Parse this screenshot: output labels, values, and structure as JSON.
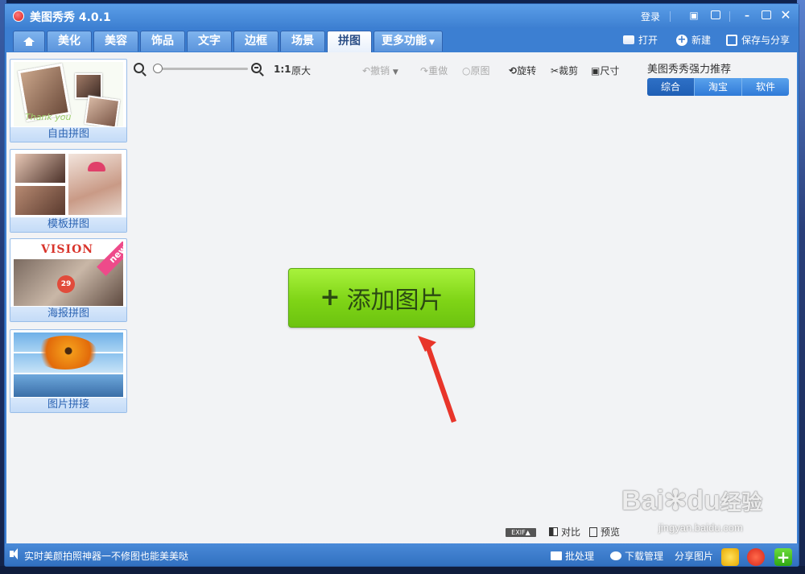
{
  "app": {
    "title": "美图秀秀 4.0.1"
  },
  "titlebar": {
    "login_label": "登录"
  },
  "tabs": [
    {
      "label": "",
      "icon": "home-icon"
    },
    {
      "label": "美化"
    },
    {
      "label": "美容"
    },
    {
      "label": "饰品"
    },
    {
      "label": "文字"
    },
    {
      "label": "边框"
    },
    {
      "label": "场景"
    },
    {
      "label": "拼图",
      "active": true
    },
    {
      "label": "更多功能"
    }
  ],
  "actions": {
    "open": "打开",
    "new": "新建",
    "save_share": "保存与分享"
  },
  "sidebar": {
    "cards": [
      {
        "label": "自由拼图",
        "thumb_text": "Thank you"
      },
      {
        "label": "模板拼图"
      },
      {
        "label": "海报拼图",
        "thumb_text": "VISION",
        "badge": "new",
        "dot_text": "29"
      },
      {
        "label": "图片拼接"
      }
    ]
  },
  "toolbar": {
    "zoom_ratio": "1:1",
    "original_size": "原大",
    "undo": "撤销",
    "redo": "重做",
    "original": "原图",
    "rotate": "旋转",
    "crop": "裁剪",
    "size": "尺寸"
  },
  "recommend": {
    "title": "美图秀秀强力推荐",
    "tabs": [
      "综合",
      "淘宝",
      "软件"
    ]
  },
  "canvas": {
    "add_button_label": "添加图片",
    "add_button_plus": "+"
  },
  "bottom_tools": {
    "exif": "EXIF▲",
    "compare": "对比",
    "preview": "预览"
  },
  "statusbar": {
    "message": "实时美颜拍照神器一不修图也能美美哒",
    "batch": "批处理",
    "download_manager": "下载管理",
    "share_image": "分享图片"
  },
  "watermark": {
    "brand": "Bai",
    "brand_tail": "du",
    "cn": "经验",
    "url": "jingyan.baidu.com"
  },
  "colors": {
    "accent": "#3c7fd2",
    "add_button": "#7fd416",
    "arrow": "#e8352a"
  }
}
